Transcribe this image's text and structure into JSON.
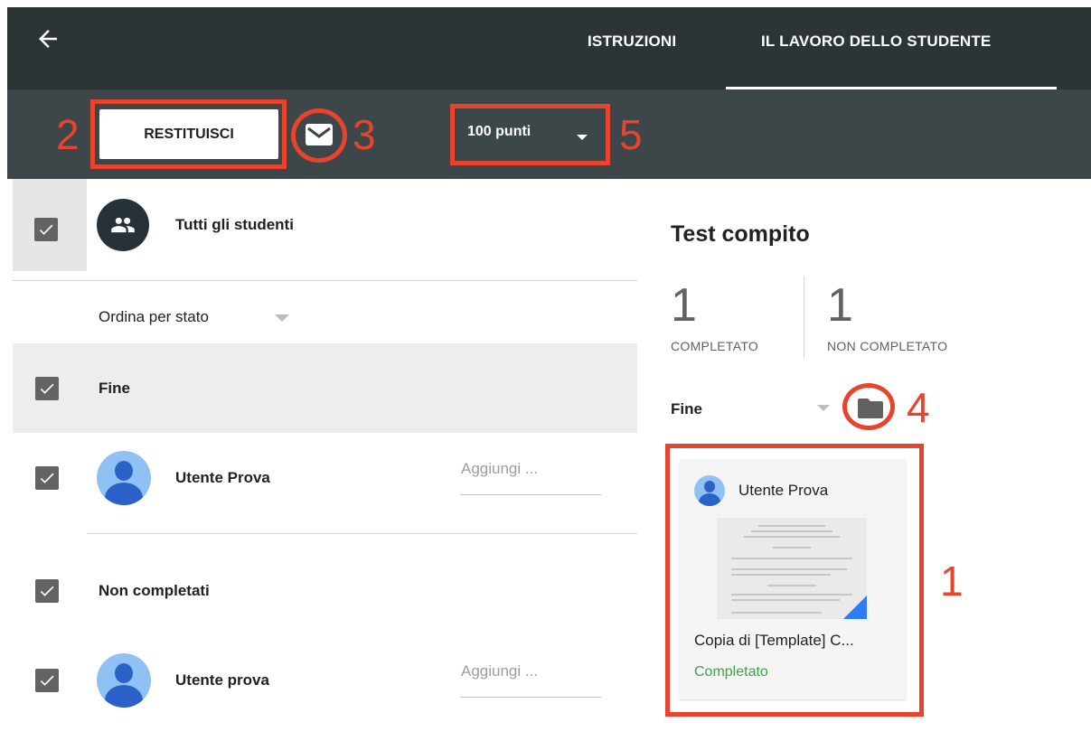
{
  "header": {
    "tabs": [
      {
        "label": "ISTRUZIONI",
        "active": false
      },
      {
        "label": "IL LAVORO DELLO STUDENTE",
        "active": true
      }
    ]
  },
  "toolbar": {
    "return_label": "RESTITUISCI",
    "points_label": "100 punti"
  },
  "annotations": {
    "n1": "1",
    "n2": "2",
    "n3": "3",
    "n4": "4",
    "n5": "5"
  },
  "students": {
    "all_label": "Tutti gli studenti",
    "sort_label": "Ordina per stato",
    "groups": [
      {
        "label": "Fine",
        "rows": [
          {
            "name": "Utente Prova",
            "grade_placeholder": "Aggiungi ..."
          }
        ]
      },
      {
        "label": "Non completati",
        "rows": [
          {
            "name": "Utente prova",
            "grade_placeholder": "Aggiungi ..."
          }
        ]
      }
    ]
  },
  "assignment": {
    "title": "Test compito",
    "completed": {
      "value": "1",
      "label": "COMPLETATO"
    },
    "not_completed": {
      "value": "1",
      "label": "NON COMPLETATO"
    },
    "filter_label": "Fine",
    "card": {
      "student": "Utente Prova",
      "file": "Copia di [Template] C...",
      "status": "Completato"
    }
  },
  "colors": {
    "annotation": "#e8432d",
    "status_complete": "#43a047",
    "topbar": "#2c3436",
    "toolbar": "#3d4649"
  },
  "icons": [
    "back-arrow-icon",
    "mail-icon",
    "dropdown-arrow-icon",
    "group-icon",
    "checkbox-icon",
    "avatar-icon",
    "folder-icon"
  ]
}
